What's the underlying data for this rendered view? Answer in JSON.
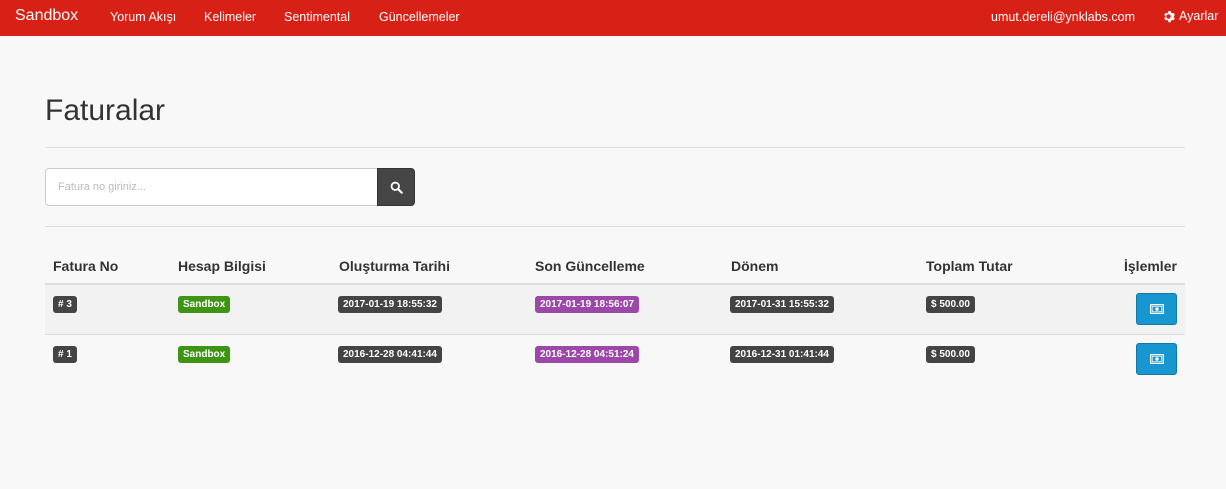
{
  "navbar": {
    "brand": "Sandbox",
    "items": [
      {
        "label": "Yorum Akışı"
      },
      {
        "label": "Kelimeler"
      },
      {
        "label": "Sentimental"
      },
      {
        "label": "Güncellemeler"
      }
    ],
    "user_email": "umut.dereli@ynklabs.com",
    "settings_label": "Ayarlar",
    "settings_icon": "gear-icon",
    "color": "#d82116"
  },
  "page": {
    "title": "Faturalar"
  },
  "search": {
    "placeholder": "Fatura no giriniz...",
    "value": "",
    "button_icon": "search-icon"
  },
  "table": {
    "headers": [
      "Fatura No",
      "Hesap Bilgisi",
      "Oluşturma Tarihi",
      "Son Güncelleme",
      "Dönem",
      "Toplam Tutar",
      "İşlemler"
    ],
    "rows": [
      {
        "invoice_no": "# 3",
        "account": "Sandbox",
        "created": "2017-01-19 18:55:32",
        "updated": "2017-01-19 18:56:07",
        "period": "2017-01-31 15:55:32",
        "total": "$ 500.00",
        "action_icon": "money-icon"
      },
      {
        "invoice_no": "# 1",
        "account": "Sandbox",
        "created": "2016-12-28 04:41:44",
        "updated": "2016-12-28 04:51:24",
        "period": "2016-12-31 01:41:44",
        "total": "$ 500.00",
        "action_icon": "money-icon"
      }
    ]
  },
  "colors": {
    "label_dark": "#444444",
    "label_green": "#3e9413",
    "label_purple": "#9c48a8",
    "action_blue": "#1796d0"
  }
}
